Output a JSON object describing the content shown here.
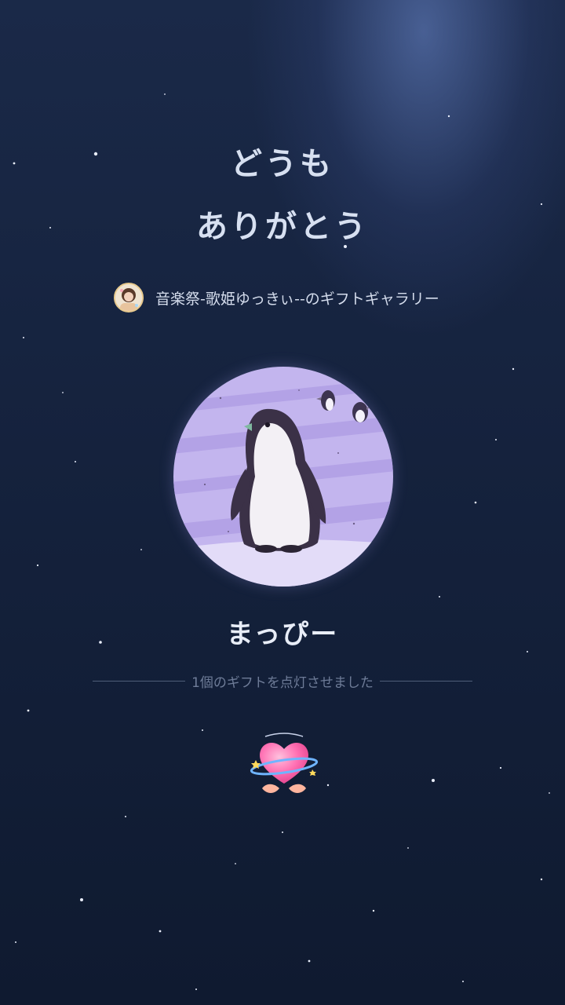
{
  "title": {
    "line1": "どうも",
    "line2": "ありがとう"
  },
  "gallery": {
    "text": "音楽祭-歌姫ゆっきぃ--のギフトギャラリー",
    "avatar_icon": "user-avatar-photo-icon"
  },
  "gift": {
    "image_icon": "penguin-illustration-icon",
    "name": "まっぴー",
    "lit_message": "1個のギフトを点灯させました"
  },
  "badge": {
    "icon": "heart-with-hands-icon"
  },
  "colors": {
    "background_top": "#1a2948",
    "background_bottom": "#0f1a30",
    "title_text": "#d7e0f1",
    "circle_bg": "#c3b5ee",
    "heart_pink": "#ff6fb2"
  }
}
